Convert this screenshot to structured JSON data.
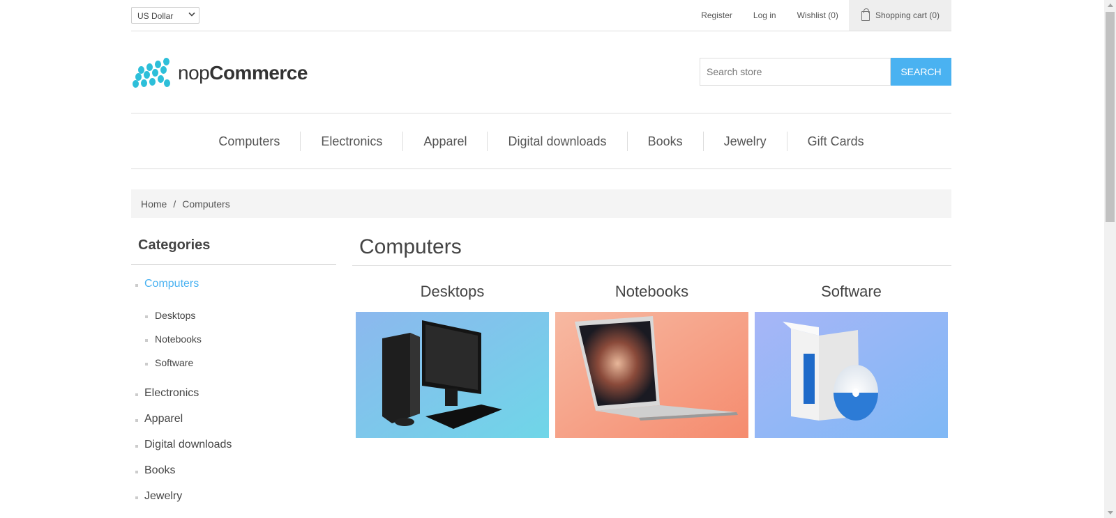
{
  "header": {
    "currency": "US Dollar",
    "links": [
      "Register",
      "Log in",
      "Wishlist (0)"
    ],
    "cart_label": "Shopping cart (0)",
    "logo_light": "nop",
    "logo_bold": "Commerce",
    "search_placeholder": "Search store",
    "search_button": "Search"
  },
  "nav": [
    "Computers",
    "Electronics",
    "Apparel",
    "Digital downloads",
    "Books",
    "Jewelry",
    "Gift Cards"
  ],
  "breadcrumb": {
    "home": "Home",
    "separator": "/",
    "current": "Computers"
  },
  "sidebar": {
    "title": "Categories",
    "active": "Computers",
    "subitems": [
      "Desktops",
      "Notebooks",
      "Software"
    ],
    "items": [
      "Electronics",
      "Apparel",
      "Digital downloads",
      "Books",
      "Jewelry"
    ]
  },
  "main": {
    "title": "Computers",
    "subcategories": [
      "Desktops",
      "Notebooks",
      "Software"
    ]
  },
  "colors": {
    "accent": "#4ab2f1",
    "logo": "#2dbfd9"
  },
  "icons": [
    "shopping-bag-icon",
    "chevron-down-icon"
  ]
}
